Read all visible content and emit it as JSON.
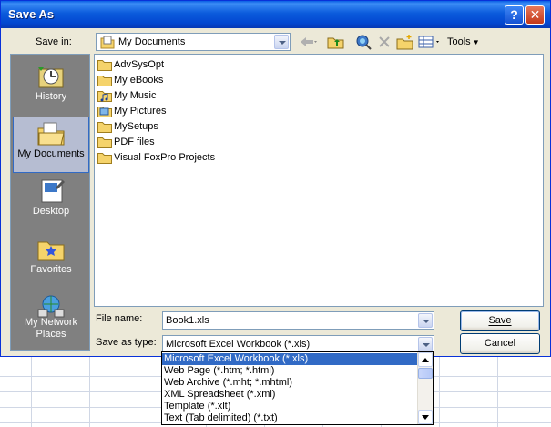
{
  "window": {
    "title": "Save As",
    "help_glyph": "?",
    "close_glyph": "✕"
  },
  "toolbar": {
    "save_in_label": "Save in:",
    "save_in_value": "My Documents",
    "back_icon": "back-arrow-icon",
    "up_icon": "up-folder-icon",
    "search_icon": "search-web-icon",
    "delete_icon": "delete-icon",
    "new_folder_icon": "new-folder-icon",
    "views_icon": "views-icon",
    "tools_label": "Tools"
  },
  "places": [
    {
      "label": "History",
      "icon": "history-icon"
    },
    {
      "label": "My Documents",
      "icon": "my-documents-icon",
      "selected": true
    },
    {
      "label": "Desktop",
      "icon": "desktop-icon"
    },
    {
      "label": "Favorites",
      "icon": "favorites-icon"
    },
    {
      "label": "My Network Places",
      "icon": "network-places-icon"
    }
  ],
  "files": [
    {
      "name": "AdvSysOpt",
      "icon": "folder-icon"
    },
    {
      "name": "My eBooks",
      "icon": "folder-icon"
    },
    {
      "name": "My Music",
      "icon": "music-folder-icon"
    },
    {
      "name": "My Pictures",
      "icon": "pictures-folder-icon"
    },
    {
      "name": "MySetups",
      "icon": "folder-icon"
    },
    {
      "name": "PDF files",
      "icon": "folder-icon"
    },
    {
      "name": "Visual FoxPro Projects",
      "icon": "folder-icon"
    }
  ],
  "form": {
    "file_name_label": "File name:",
    "file_name_value": "Book1.xls",
    "save_as_type_label": "Save as type:",
    "save_as_type_value": "Microsoft Excel Workbook (*.xls)",
    "save_label": "Save",
    "cancel_label": "Cancel"
  },
  "type_options": [
    "Microsoft Excel Workbook (*.xls)",
    "Web Page (*.htm; *.html)",
    "Web Archive (*.mht; *.mhtml)",
    "XML Spreadsheet (*.xml)",
    "Template (*.xlt)",
    "Text (Tab delimited) (*.txt)"
  ],
  "colors": {
    "title_blue": "#0b5bdc",
    "selection": "#316ac5",
    "dialog_bg": "#ece9d8",
    "folder_yellow": "#f5d36b"
  }
}
